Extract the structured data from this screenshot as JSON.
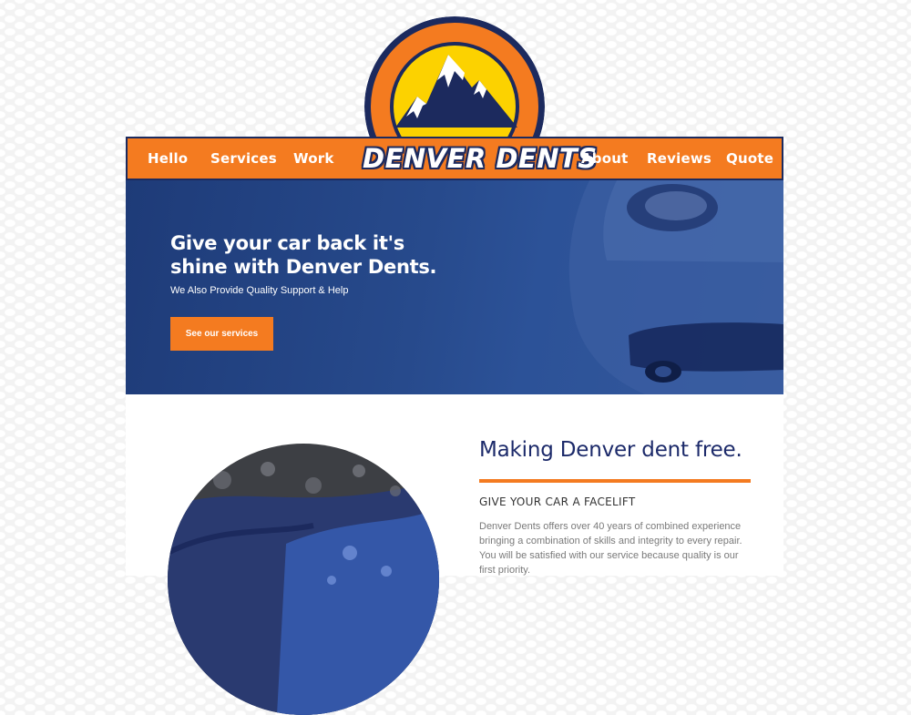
{
  "brand": {
    "name": "DENVER DENTS",
    "colors": {
      "orange": "#f47b20",
      "navy": "#1c2a5e",
      "heading_navy": "#1c2a6a",
      "yellow": "#fcd200"
    }
  },
  "nav": {
    "left_items": [
      {
        "label": "Hello"
      },
      {
        "label": "Services"
      },
      {
        "label": "Work"
      }
    ],
    "right_items": [
      {
        "label": "About"
      },
      {
        "label": "Reviews"
      },
      {
        "label": "Quote"
      }
    ]
  },
  "hero": {
    "title": "Give your car back it's shine with Denver Dents.",
    "subtitle": "We Also Provide Quality Support & Help",
    "cta_label": "See our services"
  },
  "about": {
    "heading": "Making Denver dent free.",
    "eyebrow": "GIVE YOUR CAR A FACELIFT",
    "body": "Denver Dents offers over 40 years of combined experience bringing a combination of skills and integrity to every repair. You will be satisfied with our service because quality is our first priority."
  },
  "icons": [
    "mountain-logo-icon"
  ]
}
